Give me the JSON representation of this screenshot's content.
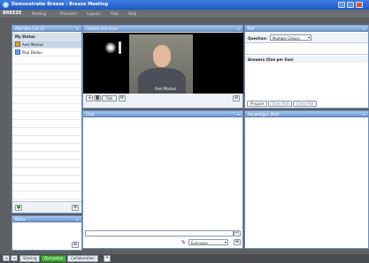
{
  "window": {
    "title": "Demonstratie Breeze : Breeze Meeting"
  },
  "menubar": {
    "logo": "BREEZE",
    "items": [
      "Meeting",
      "Presenter",
      "Layouts",
      "Pods",
      "Help"
    ]
  },
  "attendee_pod": {
    "title": "Attendee List (2)",
    "status_header": "My Status",
    "attendees": [
      {
        "name": "Axel Markus",
        "selected": true
      },
      {
        "name": "Paul Dodou",
        "selected": false
      }
    ]
  },
  "notes_pod": {
    "title": "Notes"
  },
  "camera_pod": {
    "title": "Camera and Voice",
    "video_caption": "Axel Markus",
    "talk_label": "Talk"
  },
  "chat_pod": {
    "title": "Chat",
    "to_label": "To:",
    "recipient": "Everyone"
  },
  "poll_pod": {
    "title": "Poll",
    "question_label": "Question:",
    "question_type": "Multiple Choice",
    "answers_label": "Answers (One per line)",
    "buttons": [
      "Prepare",
      "Open Poll",
      "Close Poll"
    ]
  },
  "attendees_poll_pod": {
    "title": "Aanwezigen (Poll)"
  },
  "bottombar": {
    "tabs": [
      "Sharing",
      "Discussion",
      "Collaboration"
    ],
    "active_tab": "Discussion"
  },
  "colors": {
    "titlebar": "#2a66d0",
    "pod_header": "#88afe3",
    "stage_bg": "#5d5f62",
    "active_tab": "#45b03a"
  }
}
